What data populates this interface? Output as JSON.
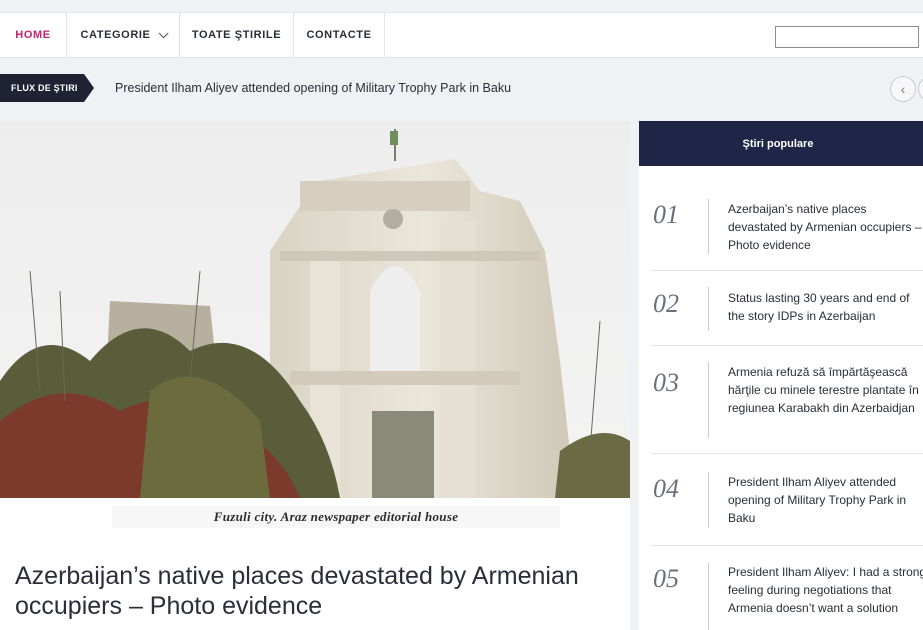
{
  "nav": {
    "items": [
      {
        "label": "HOME"
      },
      {
        "label": "CATEGORIE"
      },
      {
        "label": "TOATE ŞTIRILE"
      },
      {
        "label": "CONTACTE"
      }
    ],
    "search_value": ""
  },
  "ticker": {
    "label": "FLUX DE ŞTIRI",
    "headline": "President Ilham Aliyev attended opening of Military Trophy Park in Baku",
    "prev_icon": "chevron-left-icon"
  },
  "article": {
    "caption": "Fuzuli city. Araz newspaper editorial house",
    "headline": "Azerbaijan’s native places devastated by Armenian occupiers – Photo evidence"
  },
  "sidebar": {
    "title": "Ştiri populare",
    "items": [
      {
        "num": "01",
        "text": "Azerbaijan’s native places devastated by Armenian occupiers – Photo evidence"
      },
      {
        "num": "02",
        "text": "Status lasting 30 years and end of the story IDPs in Azerbaijan"
      },
      {
        "num": "03",
        "text": "Armenia refuză să împărtăşească hărţile cu minele terestre plantate în regiunea Karabakh din Azerbaidjan"
      },
      {
        "num": "04",
        "text": "President Ilham Aliyev attended opening of Military Trophy Park in Baku"
      },
      {
        "num": "05",
        "text": "President Ilham Aliyev: I had a strong feeling during negotiations that Armenia doesn’t want a solution"
      }
    ]
  },
  "colors": {
    "accent": "#c0246b",
    "navy": "#1f2546",
    "ticker_label_bg": "#1f2233"
  }
}
